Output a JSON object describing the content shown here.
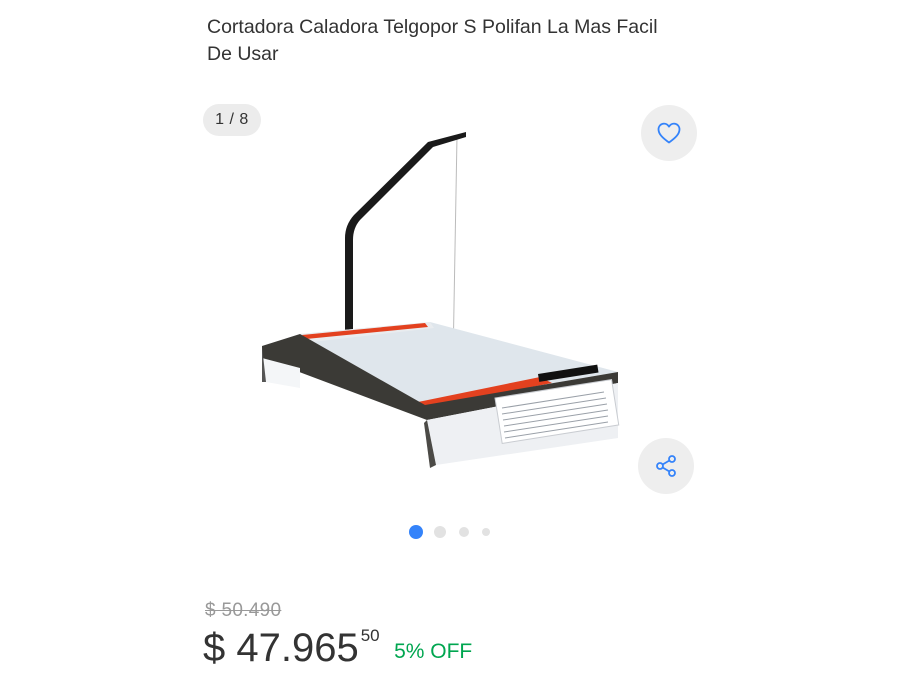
{
  "product": {
    "title": "Cortadora Caladora Telgopor S Polifan La Mas Facil De Usar"
  },
  "gallery": {
    "counter": "1 / 8",
    "image_alt": "Cortadora caladora de telgopor",
    "dots_total": 4,
    "active_dot": 0
  },
  "actions": {
    "favorite_icon": "heart-icon",
    "share_icon": "share-icon"
  },
  "price": {
    "original": "$ 50.490",
    "currency": "$",
    "amount": "47.965",
    "cents": "50",
    "discount": "5% OFF"
  },
  "colors": {
    "accent": "#3483fa",
    "discount": "#00a650",
    "text": "#333333",
    "muted": "#999999"
  }
}
